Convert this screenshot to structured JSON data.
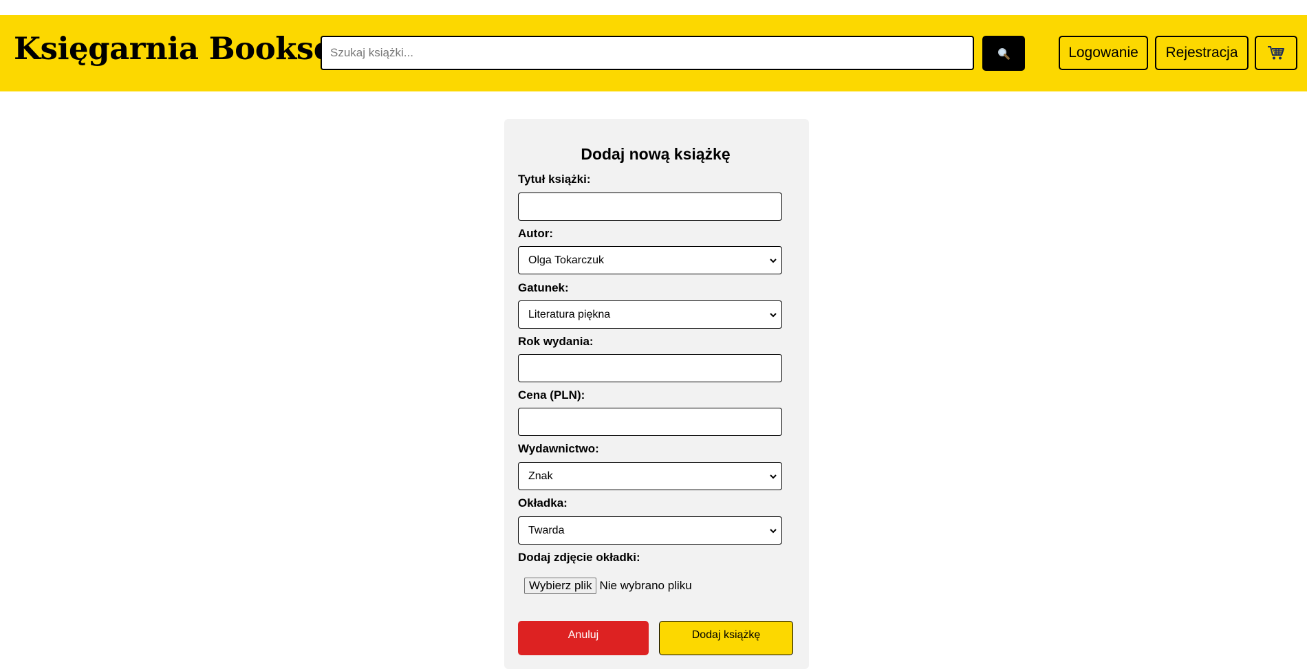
{
  "header": {
    "logo": "Księgarnia Bookser",
    "search_placeholder": "Szukaj książki...",
    "search_icon": "magnifier-icon",
    "login_label": "Logowanie",
    "register_label": "Rejestracja",
    "cart_icon": "cart-icon"
  },
  "form": {
    "title": "Dodaj nową książkę",
    "fields": {
      "title": {
        "label": "Tytuł książki:",
        "value": ""
      },
      "author": {
        "label": "Autor:",
        "value": "Olga Tokarczuk"
      },
      "genre": {
        "label": "Gatunek:",
        "value": "Literatura piękna"
      },
      "year": {
        "label": "Rok wydania:",
        "value": ""
      },
      "price": {
        "label": "Cena (PLN):",
        "value": ""
      },
      "publisher": {
        "label": "Wydawnictwo:",
        "value": "Znak"
      },
      "cover": {
        "label": "Okładka:",
        "value": "Twarda"
      },
      "cover_image": {
        "label": "Dodaj zdjęcie okładki:",
        "button_label": "Wybierz plik",
        "status": "Nie wybrano pliku"
      }
    },
    "cancel_label": "Anuluj",
    "submit_label": "Dodaj książkę"
  },
  "colors": {
    "brand_yellow": "#fcd800",
    "cancel_red": "#dd2222",
    "card_bg": "#f2f2f2"
  }
}
